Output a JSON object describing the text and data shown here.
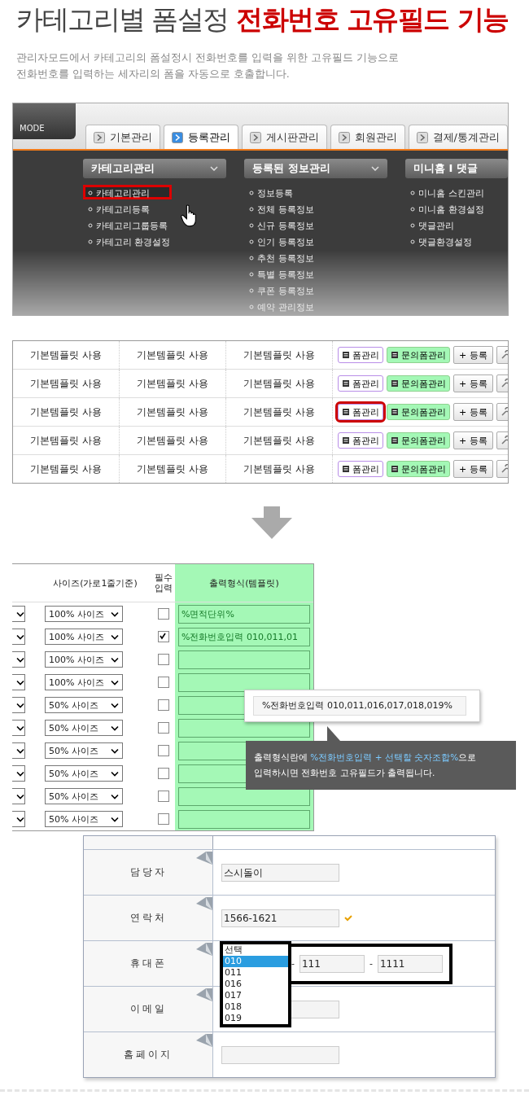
{
  "header": {
    "title": "카테고리별 폼설정",
    "title_highlight": "전화번호 고유필드 기능",
    "description": [
      "관리자모드에서 카테고리의 폼설정시 전화번호를 입력을 위한 고유필드 기능으로",
      "전화번호를 입력하는 세자리의 폼을 자동으로 호출합니다."
    ]
  },
  "admin_shot": {
    "mode_label": "MODE",
    "tabs": [
      {
        "label": "기본관리",
        "selected": false
      },
      {
        "label": "등록관리",
        "selected": true
      },
      {
        "label": "게시판관리",
        "selected": false
      },
      {
        "label": "회원관리",
        "selected": false
      },
      {
        "label": "결제/통계관리",
        "selected": false
      }
    ],
    "menu_columns": [
      {
        "title": "카테고리관리",
        "items": [
          {
            "label": "카테고리관리",
            "highlighted": true
          },
          {
            "label": "카테고리등록",
            "highlighted": false
          },
          {
            "label": "카테고리그룹등록",
            "highlighted": false
          },
          {
            "label": "카테고리 환경설정",
            "highlighted": false
          }
        ]
      },
      {
        "title": "등록된 정보관리",
        "items": [
          {
            "label": "정보등록",
            "highlighted": false
          },
          {
            "label": "전체 등록정보",
            "highlighted": false
          },
          {
            "label": "신규 등록정보",
            "highlighted": false
          },
          {
            "label": "인기 등록정보",
            "highlighted": false
          },
          {
            "label": "추천 등록정보",
            "highlighted": false
          },
          {
            "label": "특별 등록정보",
            "highlighted": false
          },
          {
            "label": "쿠폰 등록정보",
            "highlighted": false
          },
          {
            "label": "예약 관리정보",
            "highlighted": false
          }
        ]
      },
      {
        "title": "미니홈 I 댓글",
        "items": [
          {
            "label": "미니홈 스킨관리",
            "highlighted": false
          },
          {
            "label": "미니홈 환경설정",
            "highlighted": false
          },
          {
            "label": "댓글관리",
            "highlighted": false
          },
          {
            "label": "댓글환경설정",
            "highlighted": false
          }
        ]
      }
    ]
  },
  "template_table": {
    "rows": [
      {
        "cells": [
          "기본템플릿 사용",
          "기본템플릿 사용",
          "기본템플릿 사용"
        ],
        "form_button": "폼관리",
        "inquiry_button": "문의폼관리",
        "register_button": "+ 등록",
        "highlighted": false
      },
      {
        "cells": [
          "기본템플릿 사용",
          "기본템플릿 사용",
          "기본템플릿 사용"
        ],
        "form_button": "폼관리",
        "inquiry_button": "문의폼관리",
        "register_button": "+ 등록",
        "highlighted": false
      },
      {
        "cells": [
          "기본템플릿 사용",
          "기본템플릿 사용",
          "기본템플릿 사용"
        ],
        "form_button": "폼관리",
        "inquiry_button": "문의폼관리",
        "register_button": "+ 등록",
        "highlighted": true
      },
      {
        "cells": [
          "기본템플릿 사용",
          "기본템플릿 사용",
          "기본템플릿 사용"
        ],
        "form_button": "폼관리",
        "inquiry_button": "문의폼관리",
        "register_button": "+ 등록",
        "highlighted": false
      },
      {
        "cells": [
          "기본템플릿 사용",
          "기본템플릿 사용",
          "기본템플릿 사용"
        ],
        "form_button": "폼관리",
        "inquiry_button": "문의폼관리",
        "register_button": "+ 등록",
        "highlighted": false
      }
    ]
  },
  "form_settings": {
    "columns": [
      "사이즈(가로1줄기준)",
      "필수 입력",
      "출력형식(템플릿)"
    ],
    "rows": [
      {
        "size": "100% 사이즈",
        "required": false,
        "template": "%면적단위%"
      },
      {
        "size": "100% 사이즈",
        "required": true,
        "template": "%전화번호입력 010,011,01"
      },
      {
        "size": "100% 사이즈",
        "required": false
      },
      {
        "size": "100% 사이즈",
        "required": false
      },
      {
        "size": "50% 사이즈",
        "required": false
      },
      {
        "size": "50% 사이즈",
        "required": false
      },
      {
        "size": "50% 사이즈",
        "required": false
      },
      {
        "size": "50% 사이즈",
        "required": false
      },
      {
        "size": "50% 사이즈",
        "required": false
      },
      {
        "size": "50% 사이즈",
        "required": false
      }
    ],
    "example": "%전화번호입력 010,011,016,017,018,019%",
    "note": {
      "before": "출력형식란에 ",
      "highlight": "%전화번호입력 + 선택할 숫자조합%",
      "after": "으로",
      "second_line": "입력하시면 전화번호 고유필드가 출력됩니다."
    }
  },
  "form_preview": {
    "rows": [
      {
        "kind": "text",
        "label": "담당자",
        "value": "스시돌이"
      },
      {
        "kind": "text",
        "label": "연락처",
        "value": "1566-1621",
        "valid": true
      },
      {
        "kind": "phone",
        "label": "휴대폰",
        "options": [
          {
            "label": "선택",
            "selected": false
          },
          {
            "label": "010",
            "selected": true
          },
          {
            "label": "011",
            "selected": false
          },
          {
            "label": "016",
            "selected": false
          },
          {
            "label": "017",
            "selected": false
          },
          {
            "label": "018",
            "selected": false
          },
          {
            "label": "019",
            "selected": false
          }
        ],
        "separator": "-",
        "middle": "111",
        "last": "1111"
      },
      {
        "kind": "text",
        "label": "이메일"
      },
      {
        "kind": "text",
        "label": "홈페이지"
      }
    ]
  }
}
